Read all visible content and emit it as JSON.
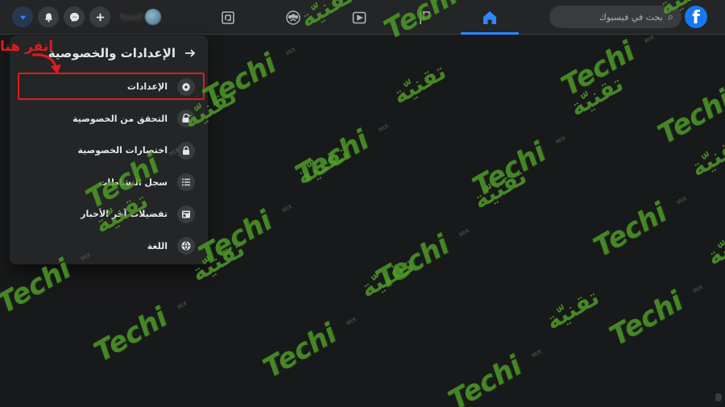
{
  "topbar": {
    "search_placeholder": "بحث في فيسبوك",
    "logo_letter": "f",
    "profile_name": "Yosef",
    "nav_tabs": [
      {
        "name": "home",
        "icon": "home-icon",
        "active": true
      },
      {
        "name": "pages",
        "icon": "flag-icon",
        "active": false
      },
      {
        "name": "watch",
        "icon": "video-icon",
        "active": false
      },
      {
        "name": "groups",
        "icon": "groups-icon",
        "active": false
      },
      {
        "name": "gaming",
        "icon": "gaming-icon",
        "active": false
      }
    ],
    "accent_color": "#2d88ff"
  },
  "panel": {
    "title": "الإعدادات والخصوصية",
    "items": [
      {
        "label": "الإعدادات",
        "icon": "gear-icon"
      },
      {
        "label": "التحقق من الخصوصية",
        "icon": "lock-check-icon"
      },
      {
        "label": "اختصارات الخصوصية",
        "icon": "lock-icon"
      },
      {
        "label": "سجل النشاطات",
        "icon": "list-icon"
      },
      {
        "label": "تفضيلات آخر الأخبار",
        "icon": "news-feed-icon"
      },
      {
        "label": "اللغة",
        "icon": "globe-icon"
      }
    ]
  },
  "annotation": {
    "text": "انقر هنا",
    "color": "#e01b1b"
  },
  "watermark": {
    "latin": "Techi",
    "arabic": "تقنيّة",
    "small": "MIX"
  }
}
